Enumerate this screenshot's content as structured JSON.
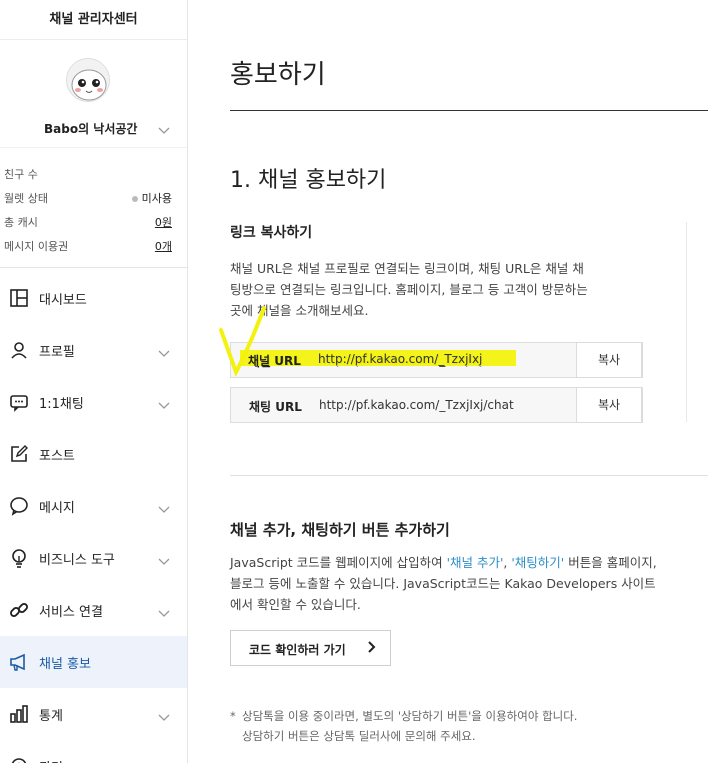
{
  "sidebar": {
    "title": "채널 관리자센터",
    "profile_name": "Babo의 낙서공간",
    "stats": [
      {
        "label": "친구 수",
        "value": ""
      },
      {
        "label": "월렛 상태",
        "value": "미사용"
      },
      {
        "label": "총 캐시",
        "value": "0원"
      },
      {
        "label": "메시지 이용권",
        "value": "0개"
      }
    ],
    "menu": [
      {
        "label": "대시보드",
        "icon": "dashboard-icon"
      },
      {
        "label": "프로필",
        "icon": "person-icon"
      },
      {
        "label": "1:1채팅",
        "icon": "chat-icon"
      },
      {
        "label": "포스트",
        "icon": "edit-icon"
      },
      {
        "label": "메시지",
        "icon": "message-icon"
      },
      {
        "label": "비즈니스 도구",
        "icon": "bulb-icon"
      },
      {
        "label": "서비스 연결",
        "icon": "link-icon"
      },
      {
        "label": "채널 홍보",
        "icon": "megaphone-icon"
      },
      {
        "label": "통계",
        "icon": "bar-chart-icon"
      },
      {
        "label": "관리",
        "icon": "settings-icon"
      }
    ]
  },
  "main": {
    "page_title": "홍보하기",
    "section1_title": "1. 채널 홍보하기",
    "link_copy_title": "링크 복사하기",
    "link_copy_desc": "채널 URL은 채널 프로필로 연결되는 링크이며, 채팅 URL은 채널 채팅방으로 연결되는 링크입니다. 홈페이지, 블로그 등 고객이 방문하는 곳에 채널을 소개해보세요.",
    "urls": [
      {
        "label": "채널 URL",
        "value": "http://pf.kakao.com/_TzxjIxj",
        "copy": "복사"
      },
      {
        "label": "채팅 URL",
        "value": "http://pf.kakao.com/_TzxjIxj/chat",
        "copy": "복사"
      }
    ],
    "section2_title": "채널 추가, 채팅하기 버튼 추가하기",
    "section2_desc_a": "JavaScript 코드를 웹페이지에 삽입하여 ",
    "section2_desc_b": "'채널 추가'",
    "section2_desc_c": ", ",
    "section2_desc_d": "'채팅하기'",
    "section2_desc_e": " 버튼을 홈페이지, 블로그 등에 노출할 수 있습니다. JavaScript코드는 Kakao Developers 사이트에서 확인할 수 있습니다.",
    "code_button": "코드 확인하러 가기",
    "note_star": "*",
    "note_line1": "상담톡을 이용 중이라면, 별도의 '상담하기 버튼'을 이용하여야 합니다.",
    "note_line2": "상담하기 버튼은 상담톡 딜러사에 문의해 주세요."
  },
  "colors": {
    "accent_blue": "#2b8fc9",
    "active_menu_bg": "#eef3fb",
    "highlight": "#f3f20e"
  }
}
